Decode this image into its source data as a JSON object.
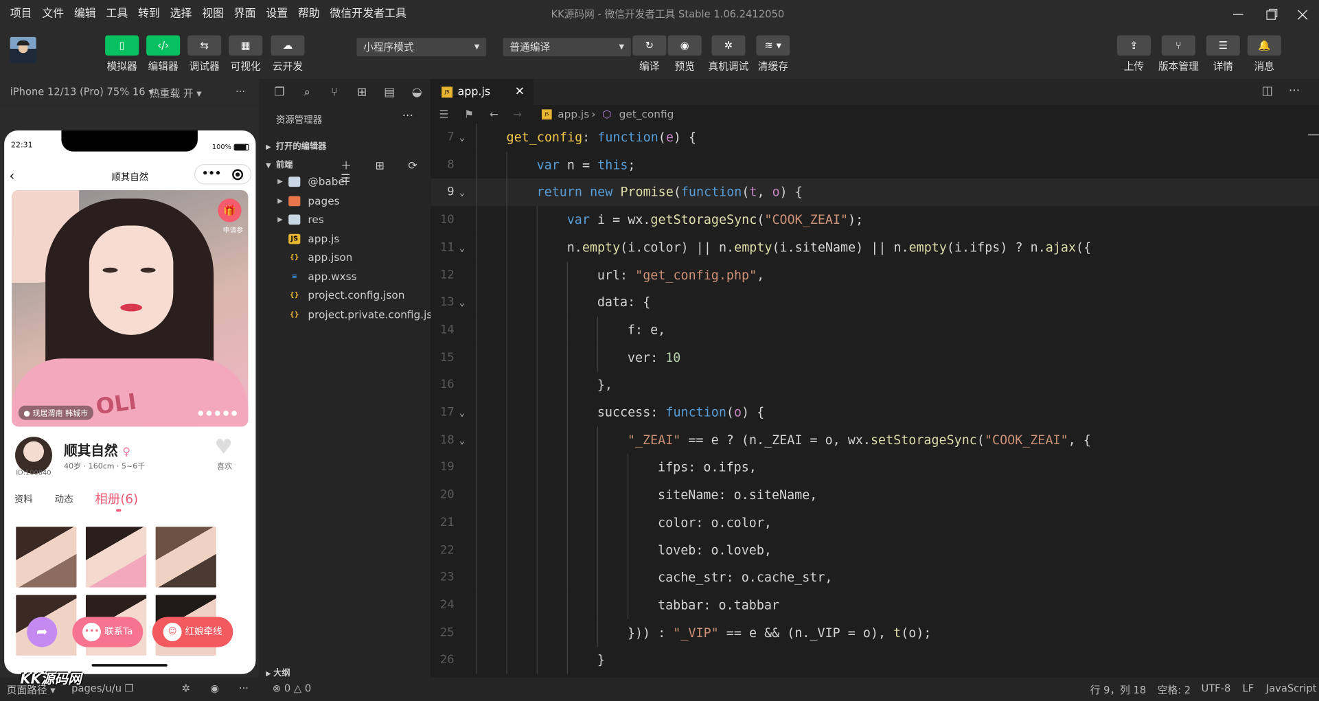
{
  "menu": [
    "项目",
    "文件",
    "编辑",
    "工具",
    "转到",
    "选择",
    "视图",
    "界面",
    "设置",
    "帮助",
    "微信开发者工具"
  ],
  "window_title": "KK源码网 - 微信开发者工具 Stable 1.06.2412050",
  "toolbar": {
    "left_buttons": [
      {
        "label": "模拟器",
        "icon": "phone-icon"
      },
      {
        "label": "编辑器",
        "icon": "code-icon"
      },
      {
        "label": "调试器",
        "icon": "debug-icon"
      },
      {
        "label": "可视化",
        "icon": "layout-icon"
      },
      {
        "label": "云开发",
        "icon": "cloud-icon"
      }
    ],
    "mode_select": "小程序模式",
    "compile_select": "普通编译",
    "mid_buttons": [
      {
        "label": "编译",
        "icon": "refresh-icon"
      },
      {
        "label": "预览",
        "icon": "eye-icon"
      },
      {
        "label": "真机调试",
        "icon": "bug-icon"
      },
      {
        "label": "清缓存",
        "icon": "layers-icon"
      }
    ],
    "right_buttons": [
      {
        "label": "上传",
        "icon": "upload-icon"
      },
      {
        "label": "版本管理",
        "icon": "branch-icon"
      },
      {
        "label": "详情",
        "icon": "menu-icon"
      },
      {
        "label": "消息",
        "icon": "bell-icon"
      }
    ]
  },
  "simulator": {
    "device": "iPhone 12/13 (Pro) 75% 16 ▾",
    "hot_reload": "热重载 开 ▾",
    "more": "···",
    "time": "22:31",
    "battery": "100%",
    "nav_title": "顺其自然",
    "capsule_dots": "•••",
    "gift_label": "申请参",
    "location": "现居渭南 韩城市",
    "dots": "●●●●●",
    "user_id": "ID:100840",
    "user_name": "顺其自然",
    "user_meta": "40岁 · 160cm · 5~6千",
    "like_label": "喜欢",
    "tabs": [
      "资料",
      "动态",
      "相册(6)"
    ],
    "fab_share": "➦",
    "fab_contact": "联系Ta",
    "fab_matchmaker": "红娘牵线"
  },
  "watermark": "KK源码网",
  "explorer": {
    "header": "资源管理器",
    "more": "···",
    "open_editors": "打开的编辑器",
    "project": "前端",
    "tools": "＋ ⊞ ⟳ ☰",
    "files": [
      {
        "name": "@babel",
        "type": "folder",
        "icon": "folder-icon",
        "expandable": true
      },
      {
        "name": "pages",
        "type": "folder",
        "icon": "folder-pages-icon",
        "expandable": true
      },
      {
        "name": "res",
        "type": "folder",
        "icon": "folder-icon",
        "expandable": true
      },
      {
        "name": "app.js",
        "type": "js",
        "icon": "js-file-icon",
        "expandable": false
      },
      {
        "name": "app.json",
        "type": "json",
        "icon": "json-file-icon",
        "expandable": false
      },
      {
        "name": "app.wxss",
        "type": "css",
        "icon": "css-file-icon",
        "expandable": false
      },
      {
        "name": "project.config.json",
        "type": "json",
        "icon": "json-file-icon",
        "expandable": false
      },
      {
        "name": "project.private.config.js...",
        "type": "json",
        "icon": "json-file-icon",
        "expandable": false
      }
    ],
    "outline": "大纲"
  },
  "editor": {
    "tab": "app.js",
    "breadcrumb_file": "app.js",
    "breadcrumb_symbol": "get_config",
    "lines": [
      {
        "n": "7",
        "indent": 1,
        "fold": true,
        "tokens": [
          [
            "k",
            "get_config"
          ],
          [
            "t",
            ": "
          ],
          [
            "kw",
            "function"
          ],
          [
            "t",
            "("
          ],
          [
            "ws",
            "e"
          ],
          [
            "t",
            ") {"
          ]
        ]
      },
      {
        "n": "8",
        "indent": 2,
        "fold": false,
        "tokens": [
          [
            "kw",
            "var"
          ],
          [
            "t",
            " n = "
          ],
          [
            "kw",
            "this"
          ],
          [
            "t",
            ";"
          ]
        ]
      },
      {
        "n": "9",
        "indent": 2,
        "fold": true,
        "current": true,
        "tokens": [
          [
            "kw",
            "return"
          ],
          [
            "t",
            " "
          ],
          [
            "kw",
            "new"
          ],
          [
            "t",
            " "
          ],
          [
            "fn",
            "Promise"
          ],
          [
            "t",
            "("
          ],
          [
            "kw",
            "function"
          ],
          [
            "t",
            "("
          ],
          [
            "ws",
            "t"
          ],
          [
            "t",
            ", "
          ],
          [
            "ws",
            "o"
          ],
          [
            "t",
            ") {"
          ]
        ]
      },
      {
        "n": "10",
        "indent": 3,
        "fold": false,
        "tokens": [
          [
            "kw",
            "var"
          ],
          [
            "t",
            " i = wx."
          ],
          [
            "fn",
            "getStorageSync"
          ],
          [
            "t",
            "("
          ],
          [
            "s",
            "\"COOK_ZEAI\""
          ],
          [
            "t",
            ");"
          ]
        ]
      },
      {
        "n": "11",
        "indent": 3,
        "fold": true,
        "tokens": [
          [
            "t",
            "n."
          ],
          [
            "fn",
            "empty"
          ],
          [
            "t",
            "(i.color) || n."
          ],
          [
            "fn",
            "empty"
          ],
          [
            "t",
            "(i.siteName) || n."
          ],
          [
            "fn",
            "empty"
          ],
          [
            "t",
            "(i.ifps) ? n."
          ],
          [
            "fn",
            "ajax"
          ],
          [
            "t",
            "({"
          ]
        ]
      },
      {
        "n": "12",
        "indent": 4,
        "fold": false,
        "tokens": [
          [
            "t",
            "url: "
          ],
          [
            "s",
            "\"get_config.php\""
          ],
          [
            "t",
            ","
          ]
        ]
      },
      {
        "n": "13",
        "indent": 4,
        "fold": true,
        "tokens": [
          [
            "t",
            "data: {"
          ]
        ]
      },
      {
        "n": "14",
        "indent": 5,
        "fold": false,
        "tokens": [
          [
            "t",
            "f: e,"
          ]
        ]
      },
      {
        "n": "15",
        "indent": 5,
        "fold": false,
        "tokens": [
          [
            "t",
            "ver: "
          ],
          [
            "n",
            "10"
          ]
        ]
      },
      {
        "n": "16",
        "indent": 4,
        "fold": false,
        "tokens": [
          [
            "t",
            "},"
          ]
        ]
      },
      {
        "n": "17",
        "indent": 4,
        "fold": true,
        "tokens": [
          [
            "t",
            "success: "
          ],
          [
            "kw",
            "function"
          ],
          [
            "t",
            "("
          ],
          [
            "ws",
            "o"
          ],
          [
            "t",
            ") {"
          ]
        ]
      },
      {
        "n": "18",
        "indent": 5,
        "fold": true,
        "tokens": [
          [
            "s",
            "\"_ZEAI\""
          ],
          [
            "t",
            " == e ? (n._ZEAI = o, wx."
          ],
          [
            "fn",
            "setStorageSync"
          ],
          [
            "t",
            "("
          ],
          [
            "s",
            "\"COOK_ZEAI\""
          ],
          [
            "t",
            ", {"
          ]
        ]
      },
      {
        "n": "19",
        "indent": 6,
        "fold": false,
        "tokens": [
          [
            "t",
            "ifps: o.ifps,"
          ]
        ]
      },
      {
        "n": "20",
        "indent": 6,
        "fold": false,
        "tokens": [
          [
            "t",
            "siteName: o.siteName,"
          ]
        ]
      },
      {
        "n": "21",
        "indent": 6,
        "fold": false,
        "tokens": [
          [
            "t",
            "color: o.color,"
          ]
        ]
      },
      {
        "n": "22",
        "indent": 6,
        "fold": false,
        "tokens": [
          [
            "t",
            "loveb: o.loveb,"
          ]
        ]
      },
      {
        "n": "23",
        "indent": 6,
        "fold": false,
        "tokens": [
          [
            "t",
            "cache_str: o.cache_str,"
          ]
        ]
      },
      {
        "n": "24",
        "indent": 6,
        "fold": false,
        "tokens": [
          [
            "t",
            "tabbar: o.tabbar"
          ]
        ]
      },
      {
        "n": "25",
        "indent": 5,
        "fold": false,
        "tokens": [
          [
            "t",
            "})) : "
          ],
          [
            "s",
            "\"_VIP\""
          ],
          [
            "t",
            " == e && (n._VIP = o), "
          ],
          [
            "fn",
            "t"
          ],
          [
            "t",
            "(o);"
          ]
        ]
      },
      {
        "n": "26",
        "indent": 4,
        "fold": false,
        "tokens": [
          [
            "t",
            "}"
          ]
        ]
      }
    ]
  },
  "statusbar": {
    "page_path_label": "页面路径 ▾",
    "page_path": "pages/u/u",
    "errors": "⊗ 0 △ 0",
    "cursor": "行 9，列 18",
    "spaces": "空格: 2",
    "encoding": "UTF-8",
    "eol": "LF",
    "language": "JavaScript"
  },
  "colors": {
    "accent_green": "#07c160",
    "brand_pink": "#f05a77",
    "keyword": "#569cd6",
    "string": "#ce9178"
  }
}
